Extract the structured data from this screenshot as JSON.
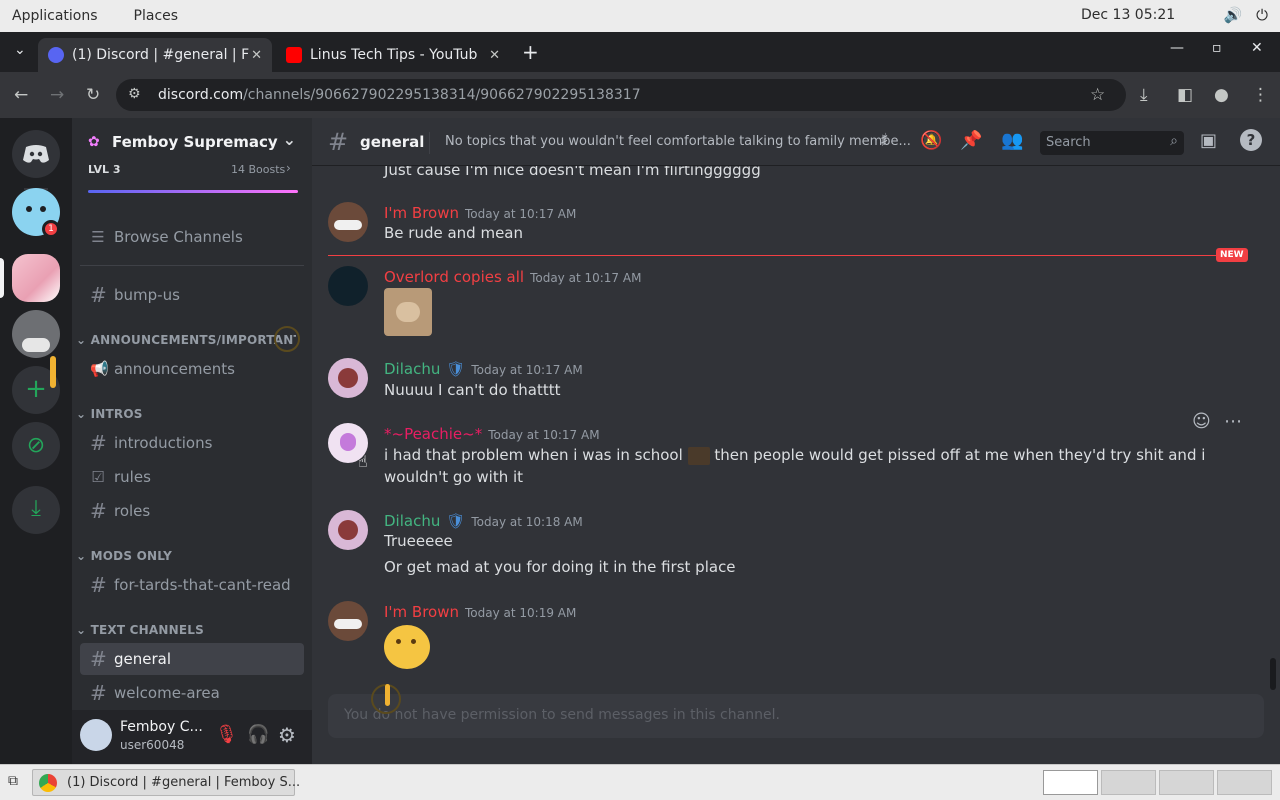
{
  "os": {
    "menu_applications": "Applications",
    "menu_places": "Places",
    "clock": "Dec 13  05:21"
  },
  "browser": {
    "tabs": [
      {
        "label": "(1) Discord | #general | F"
      },
      {
        "label": "Linus Tech Tips - YouTub"
      }
    ],
    "url_domain": "discord.com",
    "url_path": "/channels/906627902295138314/906627902295138317"
  },
  "server": {
    "name": "Femboy Supremacy",
    "level": "LVL 3",
    "boosts": "14 Boosts",
    "browse_channels": "Browse Channels",
    "channels": [
      {
        "label": "bump-us"
      },
      {
        "label": "announcements"
      },
      {
        "label": "introductions"
      },
      {
        "label": "rules"
      },
      {
        "label": "roles"
      },
      {
        "label": "for-tards-that-cant-read"
      },
      {
        "label": "general"
      },
      {
        "label": "welcome-area"
      }
    ],
    "categories": [
      {
        "label": "ANNOUNCEMENTS/IMPORTANT N..."
      },
      {
        "label": "INTROS"
      },
      {
        "label": "MODS ONLY"
      },
      {
        "label": "TEXT CHANNELS"
      }
    ]
  },
  "user": {
    "display_name": "Femboy C...",
    "username": "user60048"
  },
  "channel_header": {
    "name": "general",
    "topic": "No topics that you wouldn't feel comfortable talking to family membe...",
    "search_placeholder": "Search"
  },
  "messages": {
    "partial_top": "Just cause I'm nice doesn't mean I'm flirtingggggg",
    "m1_author": "I'm Brown",
    "m1_time": "Today at 10:17 AM",
    "m1_text": "Be rude and mean",
    "new_badge": "NEW",
    "m2_author": "Overlord copies all",
    "m2_time": "Today at 10:17 AM",
    "m3_author": "Dilachu",
    "m3_time": "Today at 10:17 AM",
    "m3_text": "Nuuuu I can't do thatttt",
    "m4_author": "*~Peachie~*",
    "m4_time": "Today at 10:17 AM",
    "m4_text_a": "i had that problem when i was in school",
    "m4_text_b": "then people would get pissed off at me when they'd try shit and i wouldn't go with it",
    "m5_author": "Dilachu",
    "m5_time": "Today at 10:18 AM",
    "m5_text_1": "Trueeeee",
    "m5_text_2": "Or get mad at you for doing it in the first place",
    "m6_author": "I'm Brown",
    "m6_time": "Today at 10:19 AM",
    "composer_placeholder": "You do not have permission to send messages in this channel."
  },
  "taskbar": {
    "window_label": "(1) Discord | #general | Femboy S..."
  },
  "colors": {
    "discord_blurple": "#5865f2",
    "mention_red": "#f23f43",
    "dilachu_green": "#43b581",
    "peachie_pink": "#e91e63"
  }
}
